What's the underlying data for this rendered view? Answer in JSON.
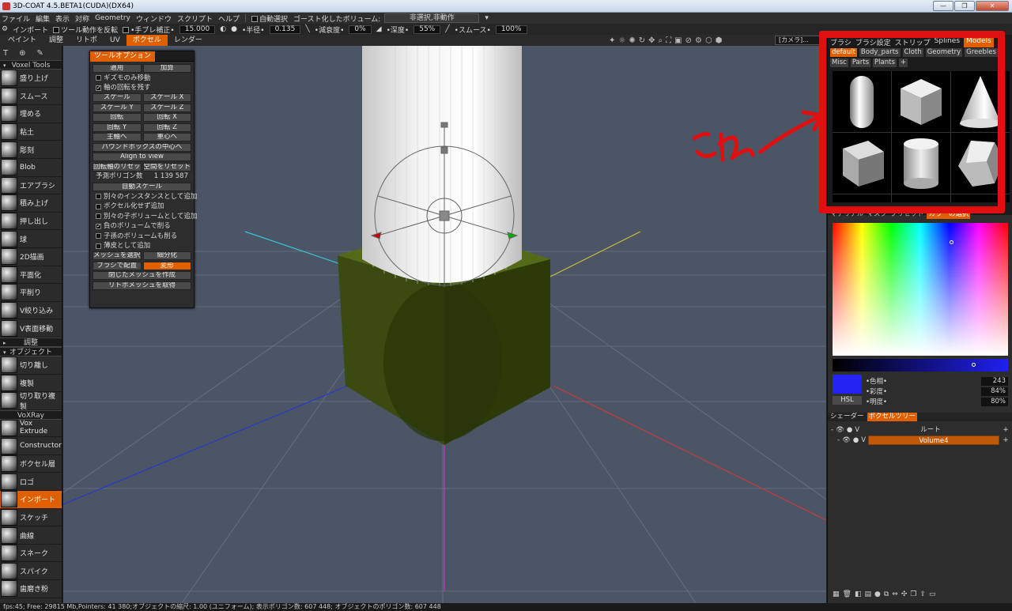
{
  "title": "3D-COAT 4.5.BETA1(CUDA)(DX64)",
  "menu": {
    "items": [
      "ファイル",
      "編集",
      "表示",
      "対称",
      "Geometry",
      "ウィンドウ",
      "スクリプト",
      "ヘルプ"
    ],
    "auto_select": "自動選択",
    "ghost_volume": "ゴースト化したボリューム:",
    "ghost_value": "非選択,非動作"
  },
  "tool_options": {
    "import": "インポート",
    "invert": "ツール動作を反転",
    "jitter_label": "•手ブレ補正•",
    "jitter_value": "15.000",
    "radius_label": "•半径•",
    "radius_value": "0.135",
    "falloff_label": "•減衰度•",
    "falloff_value": "0%",
    "depth_label": "•深度•",
    "depth_value": "55%",
    "smooth_label": "•スムース•",
    "smooth_value": "100%"
  },
  "tabs": [
    "ペイント",
    "調整",
    "リトポ",
    "UV",
    "ボクセル",
    "レンダー"
  ],
  "active_tab": "ボクセル",
  "camera": "[カメラ]...",
  "left_tools": {
    "header": "Voxel Tools",
    "group1": [
      "盛り上げ",
      "スムース",
      "埋める",
      "粘土",
      "彫刻",
      "Blob",
      "エアブラシ",
      "積み上げ",
      "押し出し",
      "球",
      "2D描画",
      "平面化",
      "平削り",
      "V絞り込み",
      "V表面移動"
    ],
    "header_adjust": "調整",
    "header_objects": "オブジェクト",
    "group2": [
      "切り離し",
      "複製",
      "切り取り複製"
    ],
    "header_voxray": "VoXRay",
    "group3": [
      "Vox Extrude",
      "Constructor",
      "ボクセル層",
      "ロゴ",
      "インポート",
      "スケッチ",
      "曲線",
      "スネーク",
      "スパイク",
      "歯磨き粉"
    ],
    "active": "インポート"
  },
  "tool_panel": {
    "title": "ツールオプション",
    "apply": "適用",
    "mode": "加算",
    "gizmo_only": "ギズモのみ移動",
    "keep_axis": "軸の回転を残す",
    "scale": "スケール",
    "scale_x": "スケール X",
    "scale_y": "スケール Y",
    "scale_z": "スケール Z",
    "rotate": "回転",
    "rotate_x": "回転 X",
    "rotate_y": "回転 Y",
    "rotate_z": "回転 Z",
    "main_axis": "主軸へ",
    "center": "重心へ",
    "bbox_center": "バウンドボックスの中心へ",
    "align_view": "Align to view",
    "reset_rot": "回転軸のリセット",
    "reset_space": "空間をリセット",
    "poly_label": "予測ポリゴン数",
    "poly_value": "1 139 587",
    "auto_scale": "自動スケール",
    "add_instance": "別々のインスタンスとして追加",
    "no_voxelize": "ボクセル化せず追加",
    "add_child": "別々の子ボリュームとして追加",
    "negative": "負のボリュームで削る",
    "sub_children": "子孫のボリュームも削る",
    "thin_add": "薄皮として追加",
    "select_mesh": "メッシュを選択",
    "subdivide": "細分化",
    "brush_place": "ブラシで配置",
    "deform": "変形",
    "closed_mesh": "閉じたメッシュを作成",
    "get_retopo": "リトポメッシュを取得"
  },
  "models_panel": {
    "tabs": [
      "ブラシ",
      "ブラシ設定",
      "ストリップ",
      "Splines",
      "Models"
    ],
    "active_tab": "Models",
    "categories": [
      "default",
      "Body_parts",
      "Cloth",
      "Geometry",
      "Greebles",
      "Misc",
      "Parts",
      "Plants",
      "+"
    ],
    "active_category": "default",
    "shapes": [
      "capsule",
      "cube",
      "cone",
      "rounded-cube",
      "cylinder",
      "hex-prism",
      "partial-1",
      "partial-2",
      "partial-3"
    ]
  },
  "annotation": "これ",
  "color_panel": {
    "tabs": [
      "マテリアル",
      "マスク",
      "プリセット",
      "カラーの選択"
    ],
    "active_tab": "カラーの選択",
    "hue_label": "•色相•",
    "hue_value": "243",
    "sat_label": "•彩度•",
    "sat_value": "84%",
    "val_label": "•明度•",
    "val_value": "80%",
    "mode": "HSL",
    "swatch_color": "#2323f3"
  },
  "tree_panel": {
    "tabs": [
      "シェーダー",
      "ボクセルツリー"
    ],
    "active_tab": "ボクセルツリー",
    "root": "ルート",
    "volume": "Volume4",
    "vis_label": "V"
  },
  "status": "fps:45;    Free: 29815 Mb,Pointers: 41 380;オブジェクトの縮尺: 1.00 (ユニフォーム); 表示ポリゴン数: 607 448; オブジェクトのポリゴン数: 607 448"
}
